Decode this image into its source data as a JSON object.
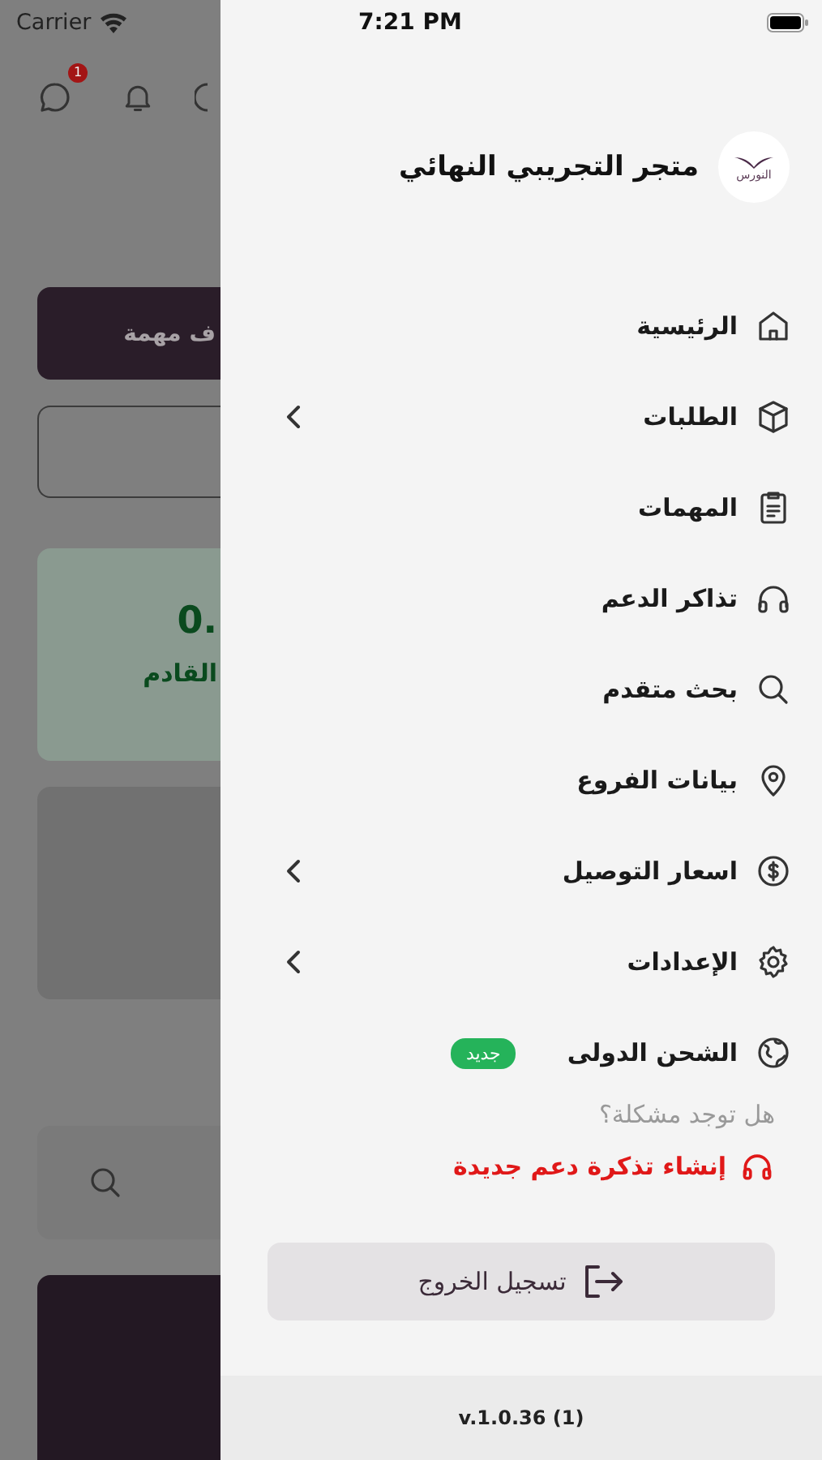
{
  "background_screen": {
    "status_bar": {
      "carrier": "Carrier"
    },
    "chat_badge": "1",
    "task_button": "ف مهمة",
    "stat_card": {
      "value": "0.",
      "label": "القادم"
    }
  },
  "status_bar": {
    "time": "7:21 PM"
  },
  "drawer": {
    "logo_text": "النورس",
    "store_name": "متجر التجريبي النهائي",
    "items": [
      {
        "label": "الرئيسية",
        "kind": "link"
      },
      {
        "label": "الطلبات",
        "kind": "group"
      },
      {
        "label": "المهمات",
        "kind": "link"
      },
      {
        "label": "تذاكر الدعم",
        "kind": "link"
      },
      {
        "label": "بحث متقدم",
        "kind": "link"
      },
      {
        "label": "بيانات الفروع",
        "kind": "link"
      },
      {
        "label": "اسعار التوصيل",
        "kind": "group"
      },
      {
        "label": "الإعدادات",
        "kind": "group"
      },
      {
        "label": "الشحن الدولى",
        "kind": "link",
        "badge": "جديد"
      }
    ],
    "help_question": "هل توجد مشكلة؟",
    "new_ticket_link": "إنشاء تذكرة دعم جديدة",
    "logout_button": "تسجيل الخروج",
    "version": "v.1.0.36 (1)"
  }
}
